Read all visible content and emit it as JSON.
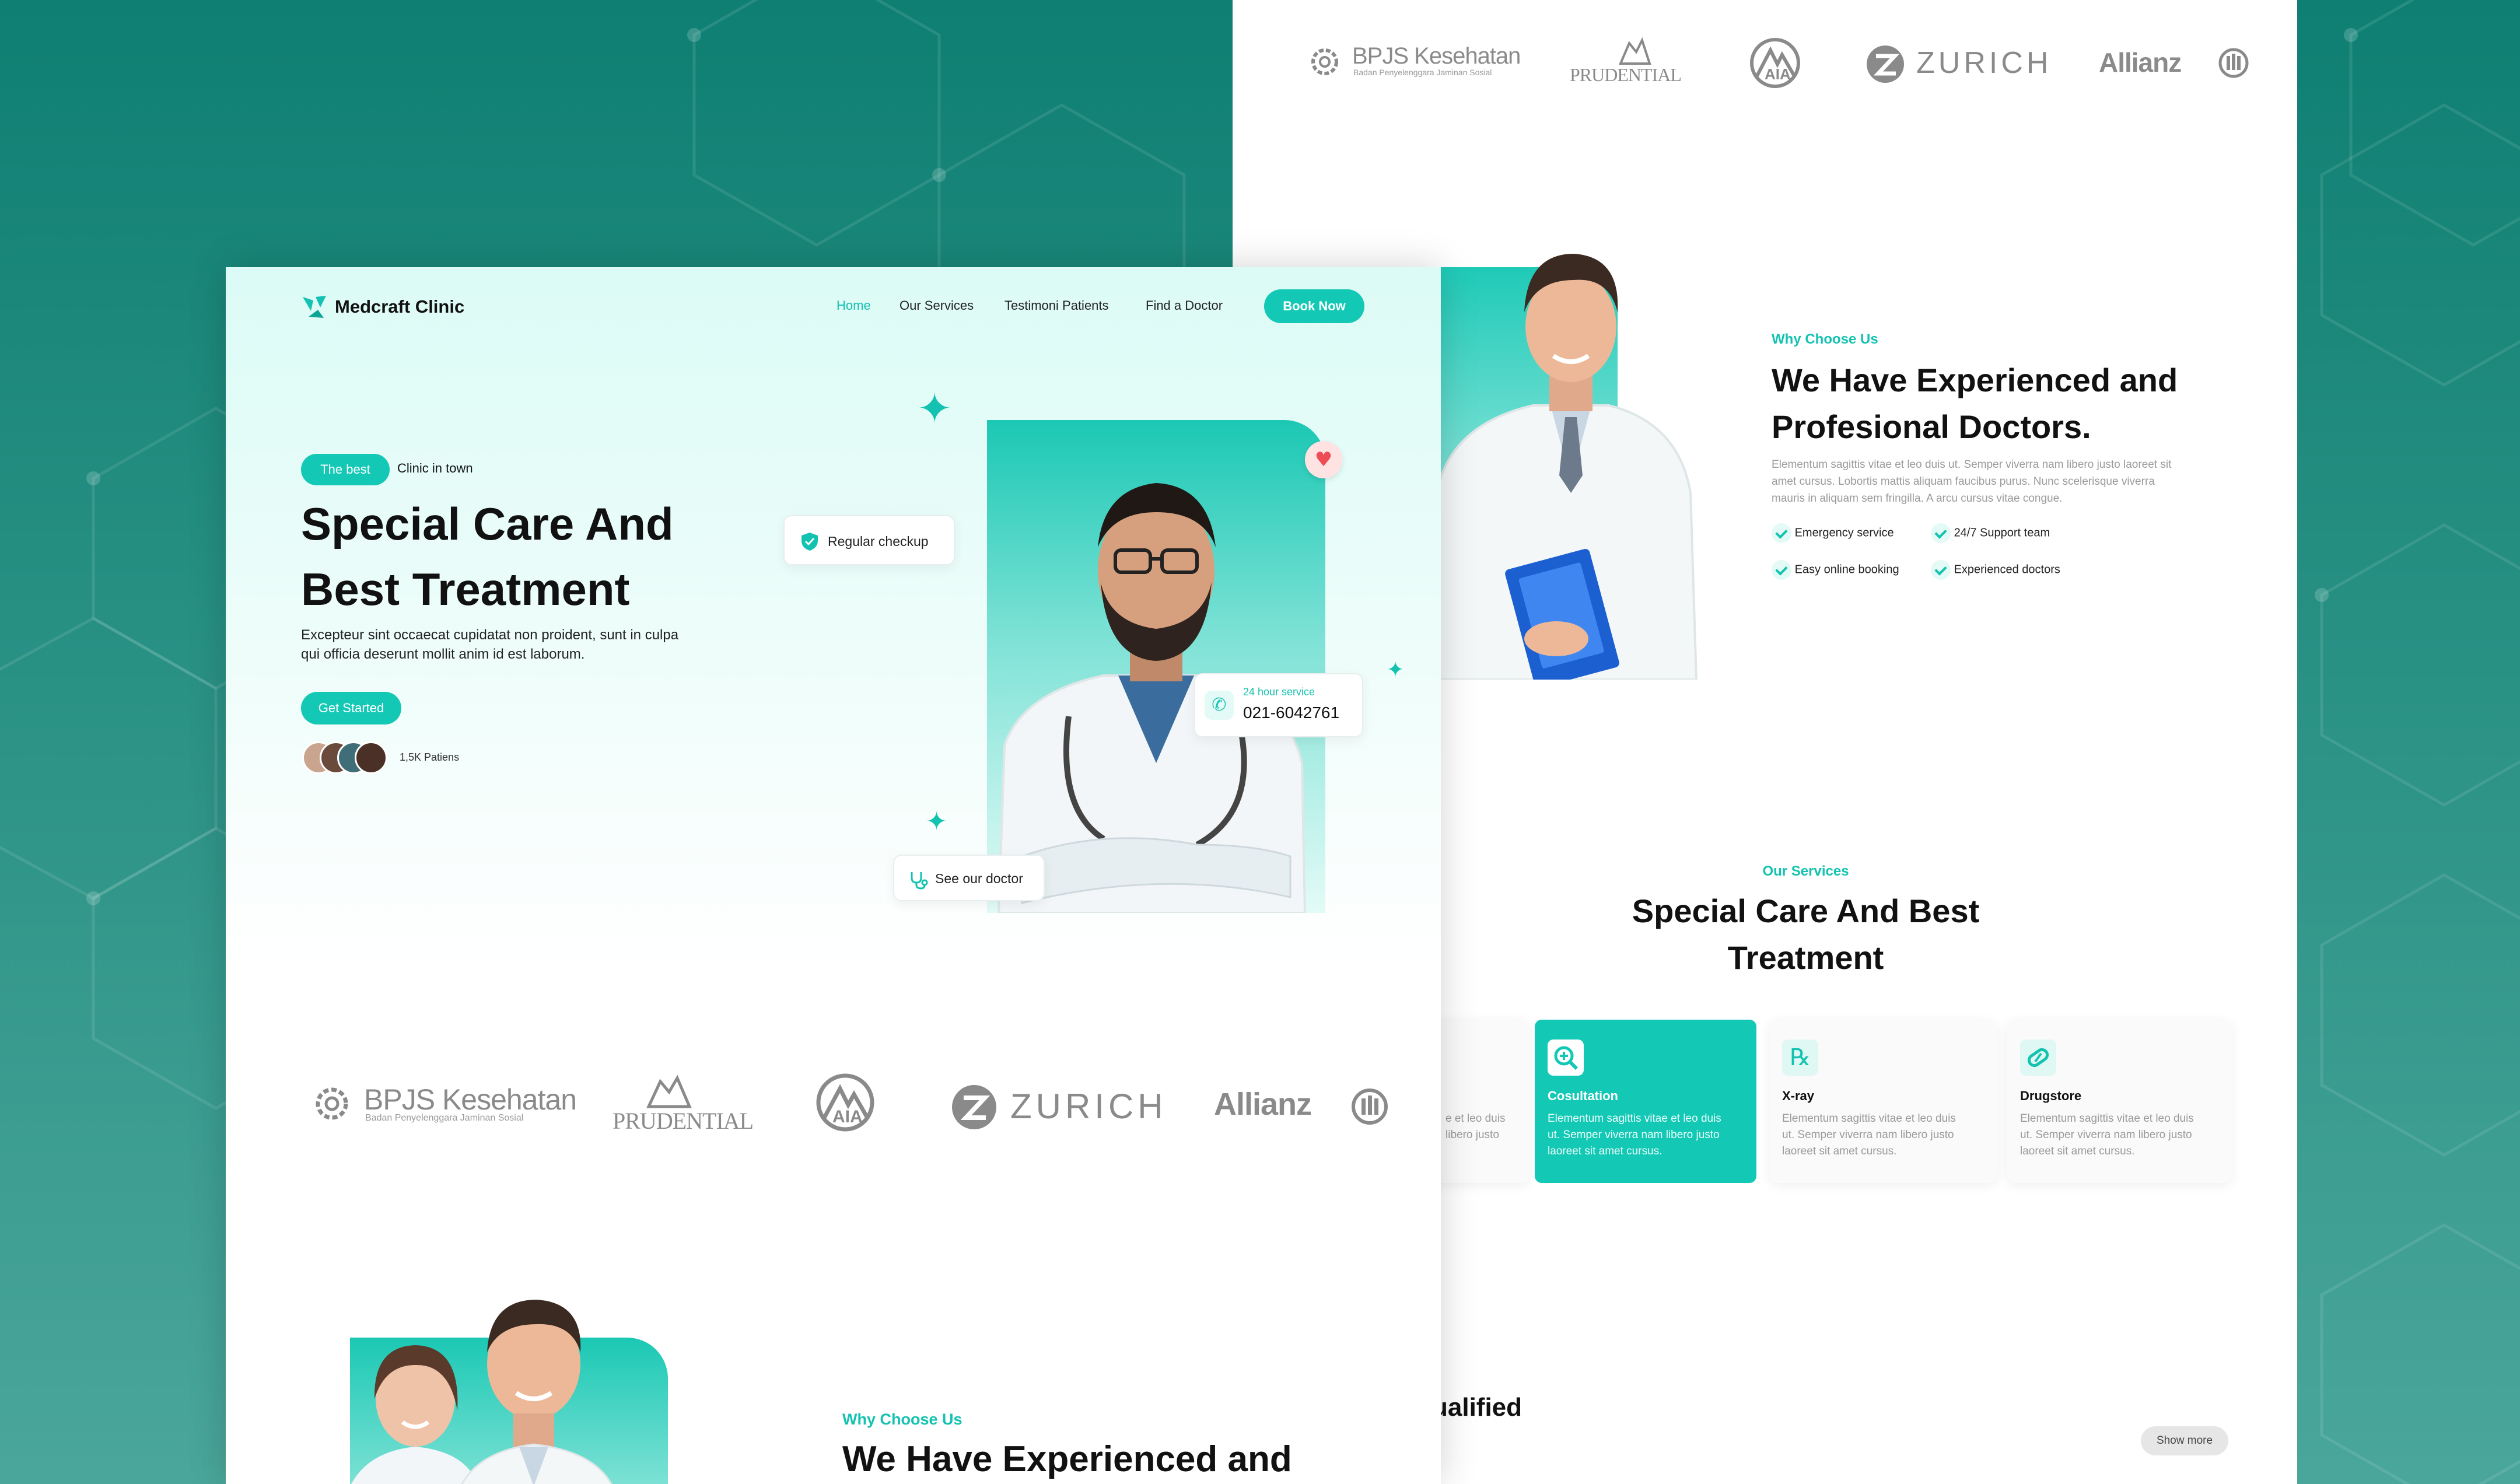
{
  "brand": {
    "name": "Medcraft Clinic"
  },
  "nav": {
    "home": "Home",
    "services": "Our Services",
    "testimoni": "Testimoni Patients",
    "find": "Find a Doctor",
    "book": "Book Now"
  },
  "hero": {
    "badge_pill": "The best",
    "badge_text": "Clinic in town",
    "title_line1": "Special Care And",
    "title_line2": "Best Treatment",
    "desc_line1": "Excepteur sint occaecat cupidatat non proident, sunt in culpa",
    "desc_line2": "qui officia deserunt mollit anim id est laborum.",
    "cta": "Get Started",
    "patients": "1,5K Patiens",
    "regular_checkup": "Regular checkup",
    "service_label": "24 hour service",
    "phone": "021-6042761",
    "see_doctor": "See our doctor"
  },
  "partners": {
    "bpjs": "BPJS Kesehatan",
    "bpjs_sub": "Badan Penyelenggara Jaminan Sosial",
    "prudential": "PRUDENTIAL",
    "aia": "AIA",
    "zurich": "ZURICH",
    "allianz": "Allianz"
  },
  "why": {
    "eyebrow": "Why Choose Us",
    "title_line1": "We Have Experienced and",
    "title_line2": "Profesional Doctors.",
    "desc_line1": "Elementum sagittis vitae et leo duis ut. Semper viverra nam libero justo laoreet sit",
    "desc_line2": "amet cursus. Lobortis mattis aliquam faucibus purus. Nunc scelerisque viverra",
    "desc_line3": "mauris in aliquam sem fringilla. A arcu cursus vitae congue.",
    "features": [
      "Emergency service",
      "24/7 Support team",
      "Easy online booking",
      "Experienced doctors"
    ]
  },
  "services": {
    "eyebrow": "Our Services",
    "title_line1": "Special Care And Best",
    "title_line2": "Treatment",
    "partial_text_1": "e et leo duis",
    "partial_text_2": "libero justo",
    "cards": [
      {
        "title": "Cosultation",
        "l1": "Elementum sagittis vitae et leo duis",
        "l2": "ut. Semper viverra nam libero justo",
        "l3": "laoreet sit amet cursus."
      },
      {
        "title": "X-ray",
        "l1": "Elementum sagittis vitae et leo duis",
        "l2": "ut. Semper viverra nam libero justo",
        "l3": "laoreet sit amet cursus."
      },
      {
        "title": "Drugstore",
        "l1": "Elementum sagittis vitae et leo duis",
        "l2": "ut. Semper viverra nam libero justo",
        "l3": "laoreet sit amet cursus."
      }
    ]
  },
  "qualified": {
    "partial": "ualified",
    "show_more": "Show more"
  },
  "left_why": {
    "eyebrow": "Why Choose Us",
    "title_partial": "We Have Experienced and"
  },
  "colors": {
    "teal": "#13c8b5",
    "dark_bg": "#0f7f73"
  }
}
